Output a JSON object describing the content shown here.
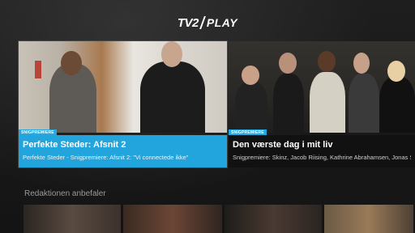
{
  "app": {
    "logo_tv2": "TV2",
    "logo_play": "PLAY"
  },
  "featured": [
    {
      "badge": "SNIGPREMIERE",
      "title": "Perfekte Steder: Afsnit 2",
      "subtitle": "Perfekte Steder - Snigpremiere: Afsnit 2: \"Vi connectede ikke\"",
      "focused": true
    },
    {
      "badge": "SNIGPREMIERE",
      "title": "Den værste dag i mit liv",
      "subtitle": "Snigpremiere: Skinz, Jacob Riising, Kathrine Abrahamsen, Jonas S...",
      "focused": false
    }
  ],
  "recommended": {
    "title": "Redaktionen anbefaler"
  },
  "colors": {
    "accent": "#22a4dd",
    "badge": "#25a8e0",
    "background": "#161616"
  }
}
